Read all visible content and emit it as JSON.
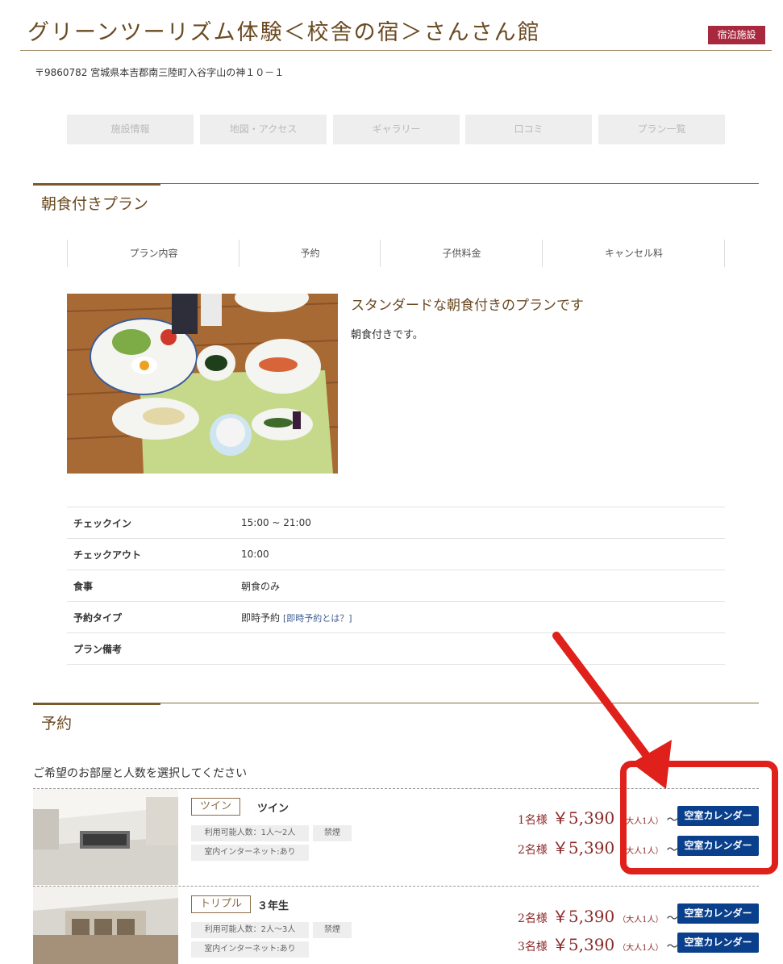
{
  "header": {
    "title": "グリーンツーリズム体験＜校舎の宿＞さんさん館",
    "badge": "宿泊施設",
    "address": "〒9860782 宮城県本吉郡南三陸町入谷字山の神１０－１"
  },
  "nav": [
    "施設情報",
    "地図・アクセス",
    "ギャラリー",
    "口コミ",
    "プラン一覧"
  ],
  "plan": {
    "section_title": "朝食付きプラン",
    "tabs": [
      "プラン内容",
      "予約",
      "子供料金",
      "キャンセル料"
    ],
    "headline": "スタンダードな朝食付きのプランです",
    "description": "朝食付きです。",
    "info": [
      {
        "label": "チェックイン",
        "value": "15:00 ~ 21:00",
        "link": ""
      },
      {
        "label": "チェックアウト",
        "value": "10:00",
        "link": ""
      },
      {
        "label": "食事",
        "value": "朝食のみ",
        "link": ""
      },
      {
        "label": "予約タイプ",
        "value": "即時予約",
        "link": "[即時予約とは？]"
      },
      {
        "label": "プラン備考",
        "value": "",
        "link": ""
      }
    ]
  },
  "reservation": {
    "section_title": "予約",
    "instruction": "ご希望のお部屋と人数を選択してください",
    "rooms": [
      {
        "type": "ツイン",
        "name": "ツイン",
        "tags": [
          "利用可能人数：1人～2人",
          "禁煙",
          "室内インターネット:あり"
        ],
        "prices": [
          {
            "count": "1名様",
            "amount": "￥5,390",
            "note": "（大人1人）",
            "tilde": "～",
            "button": "空室カレンダー"
          },
          {
            "count": "2名様",
            "amount": "￥5,390",
            "note": "（大人1人）",
            "tilde": "～",
            "button": "空室カレンダー"
          }
        ]
      },
      {
        "type": "トリプル",
        "name": "３年生",
        "tags": [
          "利用可能人数：2人～3人",
          "禁煙",
          "室内インターネット:あり"
        ],
        "prices": [
          {
            "count": "2名様",
            "amount": "￥5,390",
            "note": "（大人1人）",
            "tilde": "～",
            "button": "空室カレンダー"
          },
          {
            "count": "3名様",
            "amount": "￥5,390",
            "note": "（大人1人）",
            "tilde": "～",
            "button": "空室カレンダー"
          }
        ]
      }
    ]
  },
  "colors": {
    "brand_brown": "#6b4a22",
    "badge_red": "#a8283e",
    "button_blue": "#0a3f8c",
    "price_red": "#8c2a2a",
    "annotation_red": "#e0201b"
  }
}
